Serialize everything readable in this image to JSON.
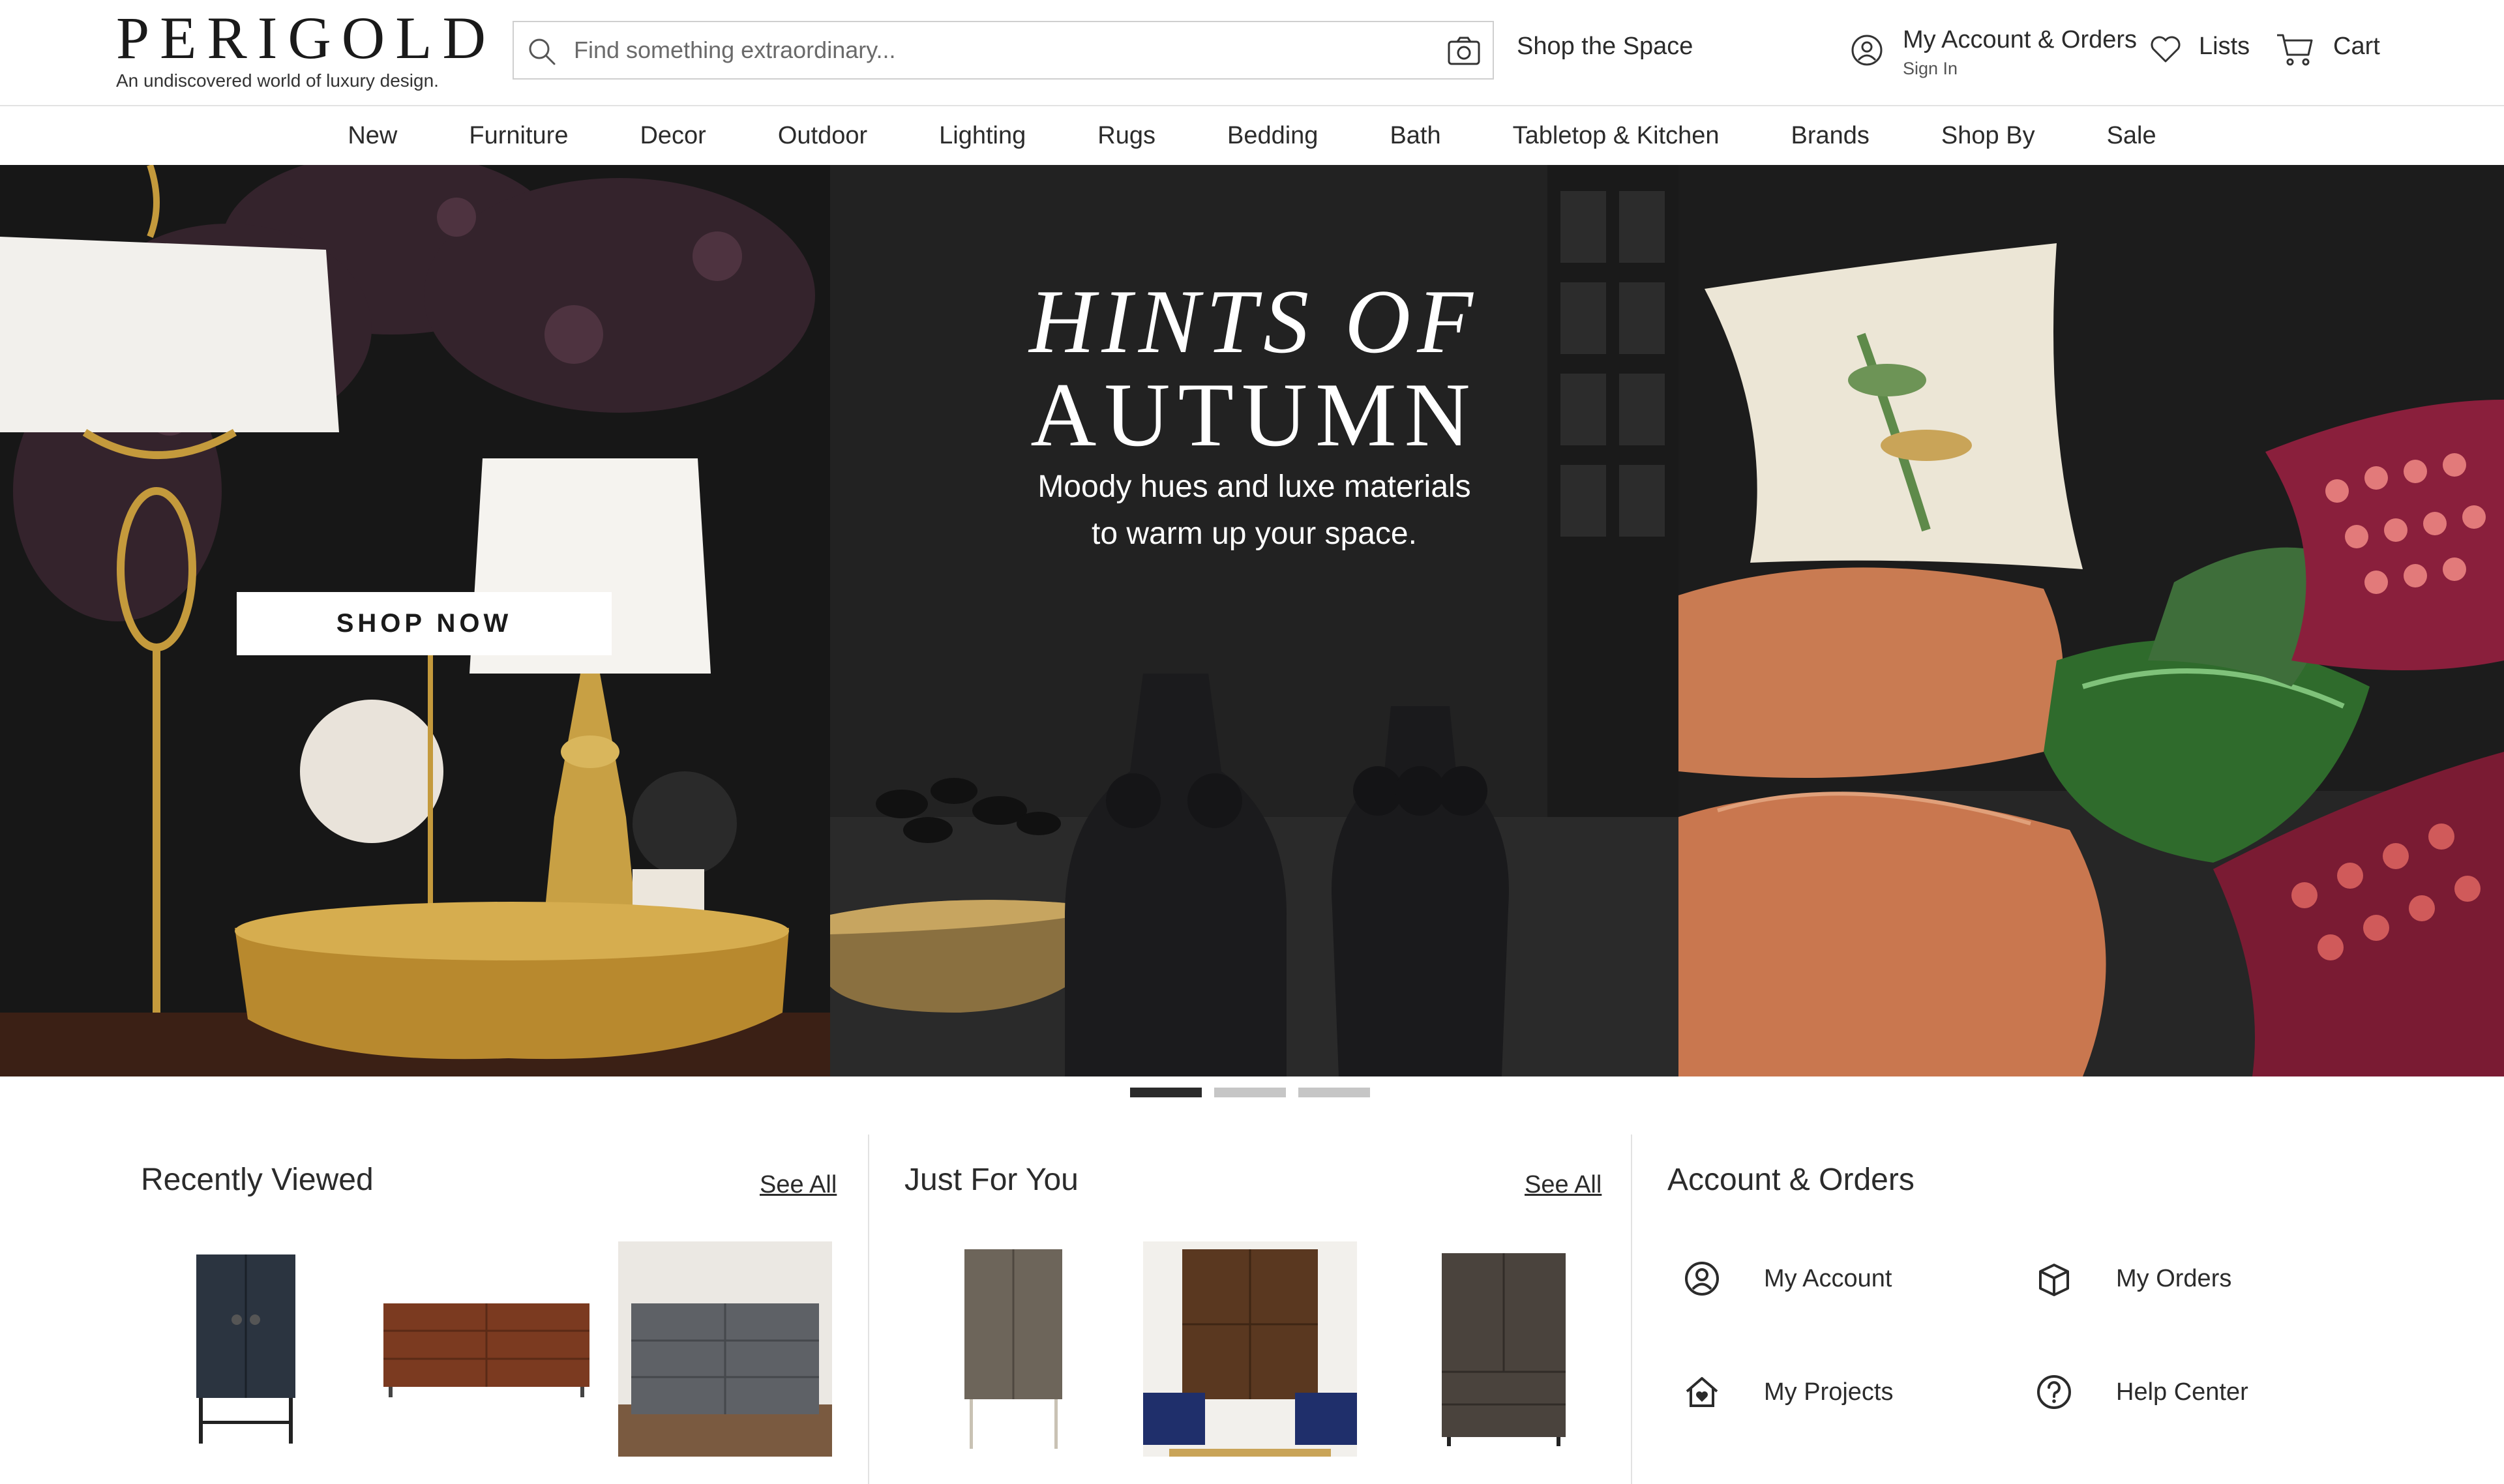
{
  "header": {
    "logo": {
      "wordmark": "PERIGOLD",
      "tagline": "An undiscovered world of luxury design."
    },
    "search": {
      "placeholder": "Find something extraordinary...",
      "value": ""
    },
    "shop_the_space": "Shop the Space",
    "account": {
      "title": "My Account & Orders",
      "subtitle": "Sign In"
    },
    "lists": "Lists",
    "cart": "Cart"
  },
  "nav": {
    "items": [
      "New",
      "Furniture",
      "Decor",
      "Outdoor",
      "Lighting",
      "Rugs",
      "Bedding",
      "Bath",
      "Tabletop & Kitchen",
      "Brands",
      "Shop By",
      "Sale"
    ]
  },
  "hero": {
    "title_line1": "HINTS OF",
    "title_line2": "AUTUMN",
    "subtitle_line1": "Moody hues and luxe materials",
    "subtitle_line2": "to warm up your space.",
    "button": "SHOP NOW",
    "carousel": {
      "slides": 3,
      "active": 1
    }
  },
  "recently_viewed": {
    "title": "Recently Viewed",
    "see_all": "See All"
  },
  "just_for_you": {
    "title": "Just For You",
    "see_all": "See All"
  },
  "account_orders": {
    "title": "Account & Orders",
    "links": [
      {
        "label": "My Account",
        "icon": "user-circle-icon"
      },
      {
        "label": "My Orders",
        "icon": "box-icon"
      },
      {
        "label": "My Projects",
        "icon": "house-heart-icon"
      },
      {
        "label": "Help Center",
        "icon": "question-circle-icon"
      }
    ]
  },
  "colors": {
    "text": "#2b2b2b",
    "divider": "#e2e2e2",
    "dot_active": "#2b2b2b",
    "dot_inactive": "#c6c6c6"
  }
}
